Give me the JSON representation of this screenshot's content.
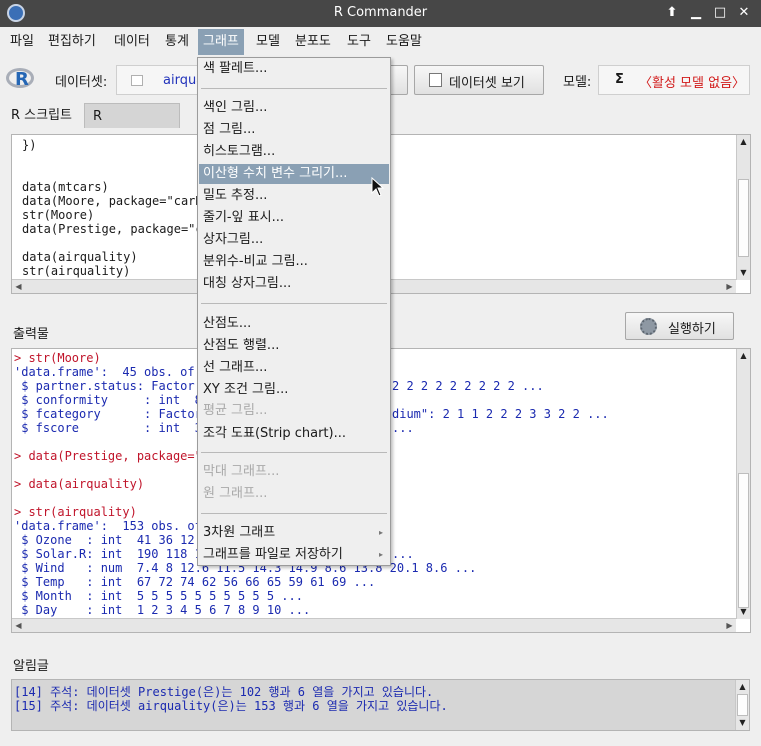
{
  "window": {
    "title": "R Commander"
  },
  "menubar": {
    "items": [
      "파일",
      "편집하기",
      "데이터",
      "통계",
      "그래프",
      "모델",
      "분포도",
      "도구",
      "도움말"
    ],
    "active": "그래프"
  },
  "toolbar": {
    "dataset_label": "데이터셋:",
    "dataset_value": "airqua",
    "edit_button_fragment": "",
    "view_button": "데이터셋 보기",
    "model_label": "모델:",
    "model_sigma": "Σ",
    "model_value": "〈활성 모델 없음〉"
  },
  "tabs": [
    "R 스크립트",
    "R Markdown"
  ],
  "script": {
    "lines": [
      "})",
      "",
      "",
      "data(mtcars)",
      "data(Moore, package=\"carDat",
      "str(Moore)",
      "data(Prestige, package=\"car",
      "",
      "data(airquality)",
      "str(airquality)"
    ]
  },
  "output": {
    "label": "출력물",
    "run_button": "실행하기",
    "lines": [
      {
        "kind": "prompt",
        "left": "> str(Moore)",
        "right": ""
      },
      {
        "kind": "out",
        "left": "'data.frame':  45 obs. of",
        "right": ""
      },
      {
        "kind": "out",
        "left": " $ partner.status: Factor",
        "right": "2 2 2 2 2 2 2 2 2 ..."
      },
      {
        "kind": "out",
        "left": " $ conformity     : int  8",
        "right": ""
      },
      {
        "kind": "out",
        "left": " $ fcategory      : Factor",
        "right": "dium\": 2 1 1 2 2 2 3 3 2 2 ..."
      },
      {
        "kind": "out",
        "left": " $ fscore         : int  37",
        "right": "..."
      },
      {
        "kind": "blank",
        "left": "",
        "right": ""
      },
      {
        "kind": "prompt",
        "left": "> data(Prestige, package=\"",
        "right": ""
      },
      {
        "kind": "blank",
        "left": "",
        "right": ""
      },
      {
        "kind": "prompt",
        "left": "> data(airquality)",
        "right": ""
      },
      {
        "kind": "blank",
        "left": "",
        "right": ""
      },
      {
        "kind": "prompt",
        "left": "> str(airquality)",
        "right": ""
      },
      {
        "kind": "out",
        "left": "'data.frame':  153 obs. of",
        "right": ""
      },
      {
        "kind": "out",
        "left": " $ Ozone  : int  41 36 12",
        "right": ""
      },
      {
        "kind": "out",
        "left": " $ Solar.R: int  190 118 14",
        "right": "..."
      },
      {
        "kind": "out",
        "left": " $ Wind   : num  7.4 8 12.6 11.5 14.3 14.9 8.6 13.8 20.1 8.6 ...",
        "right": ""
      },
      {
        "kind": "out",
        "left": " $ Temp   : int  67 72 74 62 56 66 65 59 61 69 ...",
        "right": ""
      },
      {
        "kind": "out",
        "left": " $ Month  : int  5 5 5 5 5 5 5 5 5 5 ...",
        "right": ""
      },
      {
        "kind": "out",
        "left": " $ Day    : int  1 2 3 4 5 6 7 8 9 10 ...",
        "right": ""
      }
    ]
  },
  "messages": {
    "label": "알림글",
    "lines": [
      "[14] 주석: 데이터셋 Prestige(은)는 102 행과 6 열을 가지고 있습니다.",
      "[15] 주석: 데이터셋 airquality(은)는 153 행과 6 열을 가지고 있습니다."
    ]
  },
  "graph_menu": {
    "items": [
      {
        "label": "색 팔레트...",
        "enabled": true
      },
      {
        "sep": true
      },
      {
        "label": "색인 그림...",
        "enabled": true
      },
      {
        "label": "점 그림...",
        "enabled": true
      },
      {
        "label": "히스토그램...",
        "enabled": true
      },
      {
        "label": "이산형 수치 변수 그리기...",
        "enabled": true,
        "highlighted": true
      },
      {
        "label": "밀도 추정...",
        "enabled": true
      },
      {
        "label": "줄기-잎 표시...",
        "enabled": true
      },
      {
        "label": "상자그림...",
        "enabled": true
      },
      {
        "label": "분위수-비교 그림...",
        "enabled": true
      },
      {
        "label": "대칭 상자그림...",
        "enabled": true
      },
      {
        "sep": true
      },
      {
        "label": "산점도...",
        "enabled": true
      },
      {
        "label": "산점도 행렬...",
        "enabled": true
      },
      {
        "label": "선 그래프...",
        "enabled": true
      },
      {
        "label": "XY 조건 그림...",
        "enabled": true
      },
      {
        "label": "평균 그림...",
        "enabled": false
      },
      {
        "label": "조각 도표(Strip chart)...",
        "enabled": true
      },
      {
        "sep": true
      },
      {
        "label": "막대 그래프...",
        "enabled": false
      },
      {
        "label": "원 그래프...",
        "enabled": false
      },
      {
        "sep": true
      },
      {
        "label": "3차원 그래프",
        "enabled": true,
        "submenu": true
      },
      {
        "label": "그래프를 파일로 저장하기",
        "enabled": true,
        "submenu": true
      }
    ]
  }
}
